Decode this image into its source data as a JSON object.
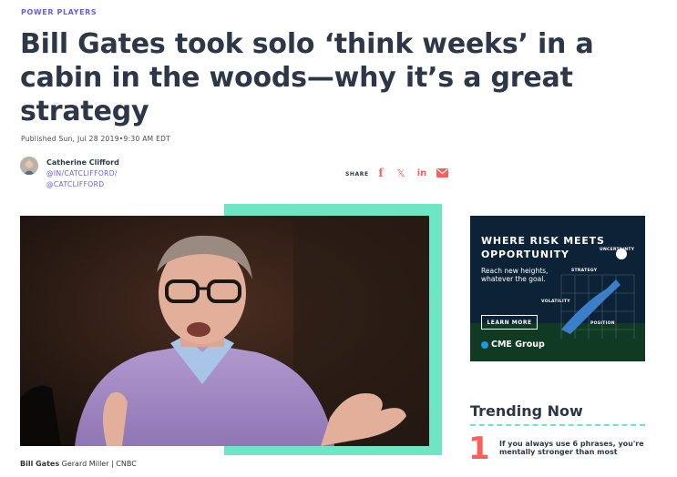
{
  "article": {
    "kicker": "POWER PLAYERS",
    "headline": "Bill Gates took solo ‘think weeks’ in a cabin in the woods—why it’s a great strategy",
    "published": "Published Sun, Jul 28 2019•9:30 AM EDT"
  },
  "author": {
    "name": "Catherine Clifford",
    "linkedin": "@IN/CATCLIFFORD/",
    "twitter": "@CATCLIFFORD"
  },
  "share": {
    "label": "SHARE",
    "icons": [
      "facebook-icon",
      "x-icon",
      "linkedin-icon",
      "email-icon"
    ],
    "facebook_glyph": "f",
    "x_glyph": "𝕏",
    "linkedin_glyph": "in"
  },
  "hero": {
    "caption_subject": "Bill Gates",
    "caption_credit": "Gerard Miller | CNBC"
  },
  "ad": {
    "title_line1": "WHERE RISK MEETS",
    "title_line2": "OPPORTUNITY",
    "sub_line1": "Reach new heights,",
    "sub_line2": "whatever the goal.",
    "button": "LEARN MORE",
    "brand": "CME Group",
    "tags": [
      "UNCERTAINTY",
      "STRATEGY",
      "VOLATILITY",
      "POSITION"
    ]
  },
  "trending": {
    "title": "Trending Now",
    "items": [
      {
        "number": "1",
        "text": "If you always use 6 phrases, you're mentally stronger than most"
      }
    ]
  },
  "colors": {
    "accent_purple": "#6c5ce7",
    "mint": "#6ee6c4",
    "coral": "#ff5c5c",
    "heading": "#2d3748"
  }
}
